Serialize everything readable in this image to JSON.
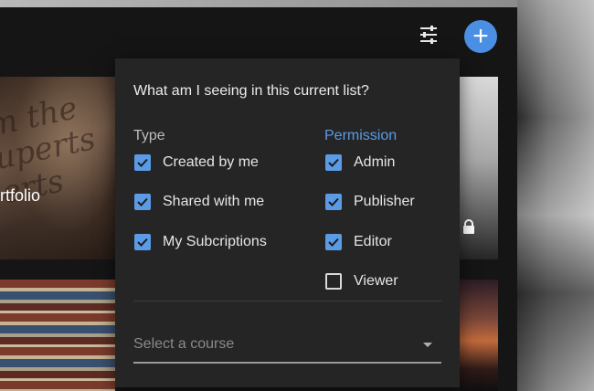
{
  "cards": [
    {
      "title": "rtfolio"
    }
  ],
  "popup": {
    "question": "What am I seeing in this current list?",
    "type_label": "Type",
    "permission_label": "Permission",
    "type_options": [
      {
        "label": "Created by me",
        "checked": true
      },
      {
        "label": "Shared with me",
        "checked": true
      },
      {
        "label": "My Subcriptions",
        "checked": true
      }
    ],
    "permission_options": [
      {
        "label": "Admin",
        "checked": true
      },
      {
        "label": "Publisher",
        "checked": true
      },
      {
        "label": "Editor",
        "checked": true
      },
      {
        "label": "Viewer",
        "checked": false
      }
    ],
    "select": {
      "placeholder": "Select a course"
    }
  },
  "colors": {
    "accent": "#5b9be6",
    "add_button": "#4a8fe3",
    "popup_bg": "#252525",
    "app_bg": "#151515"
  },
  "icons": {
    "filter": "tune-sliders-icon",
    "add": "plus-icon",
    "lock": "lock-icon",
    "dropdown": "caret-down-icon",
    "checkbox_checked": "check-icon"
  }
}
